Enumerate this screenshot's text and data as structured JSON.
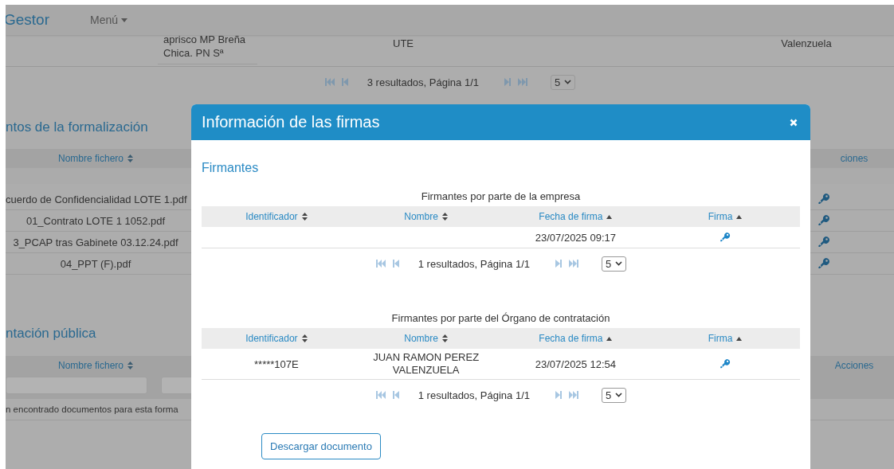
{
  "navbar": {
    "brand": "Gestor",
    "menu": "Menú"
  },
  "background": {
    "top_row": [
      "aprisco MP Breña Chica. PN Sª",
      "UTE",
      "Valenzuela"
    ],
    "pager": {
      "summary": "3 resultados, Página 1/1",
      "page_size": "5",
      "buttons": [
        {
          "kind": "first",
          "disabled": true
        },
        {
          "kind": "prev",
          "disabled": true
        },
        {
          "kind": "next",
          "disabled": true
        },
        {
          "kind": "last",
          "disabled": true
        }
      ]
    },
    "sections": [
      {
        "kind": "list",
        "title": "ntos de la formalización",
        "column": "Nombre fichero",
        "sort_ascending": false,
        "actions_column": "ciones",
        "rows": [
          "cuerdo de Confidencialidad LOTE 1.pdf",
          "01_Contrato LOTE 1 1052.pdf",
          "3_PCAP tras Gabinete 03.12.24.pdf",
          "04_PPT (F).pdf"
        ]
      },
      {
        "kind": "empty",
        "title": "ntación pública",
        "column": "Nombre fichero",
        "sort_ascending": false,
        "actions_column": "Acciones",
        "message": "n encontrado documentos para esta forma"
      }
    ]
  },
  "modal": {
    "title": "Información de las firmas",
    "section_title": "Firmantes",
    "tables": [
      {
        "caption": "Firmantes por parte de la empresa",
        "columns": [
          {
            "label": "Identificador",
            "sort_ascending": false
          },
          {
            "label": "Nombre",
            "sort_ascending": false
          },
          {
            "label": "Fecha de firma",
            "sort_ascending": true
          },
          {
            "label": "Firma",
            "sort_ascending": true
          }
        ],
        "rows": [
          {
            "date": "23/07/2025 09:17"
          }
        ],
        "pager": {
          "summary": "1 resultados, Página 1/1",
          "page_size": "5",
          "buttons": [
            {
              "kind": "first",
              "disabled": true
            },
            {
              "kind": "prev",
              "disabled": true
            },
            {
              "kind": "next",
              "disabled": true
            },
            {
              "kind": "last",
              "disabled": true
            }
          ]
        }
      },
      {
        "caption": "Firmantes por parte del Órgano de contratación",
        "columns": [
          {
            "label": "Identificador",
            "sort_ascending": false
          },
          {
            "label": "Nombre",
            "sort_ascending": false
          },
          {
            "label": "Fecha de firma",
            "sort_ascending": true
          },
          {
            "label": "Firma",
            "sort_ascending": true
          }
        ],
        "rows": [
          {
            "identifier": "*****107E",
            "name": "JUAN RAMON PEREZ VALENZUELA",
            "date": "23/07/2025 12:54"
          }
        ],
        "pager": {
          "summary": "1 resultados, Página 1/1",
          "page_size": "5",
          "buttons": [
            {
              "kind": "first",
              "disabled": true
            },
            {
              "kind": "prev",
              "disabled": true
            },
            {
              "kind": "next",
              "disabled": true
            },
            {
              "kind": "last",
              "disabled": true
            }
          ]
        }
      }
    ],
    "download_button": "Descargar documento"
  }
}
